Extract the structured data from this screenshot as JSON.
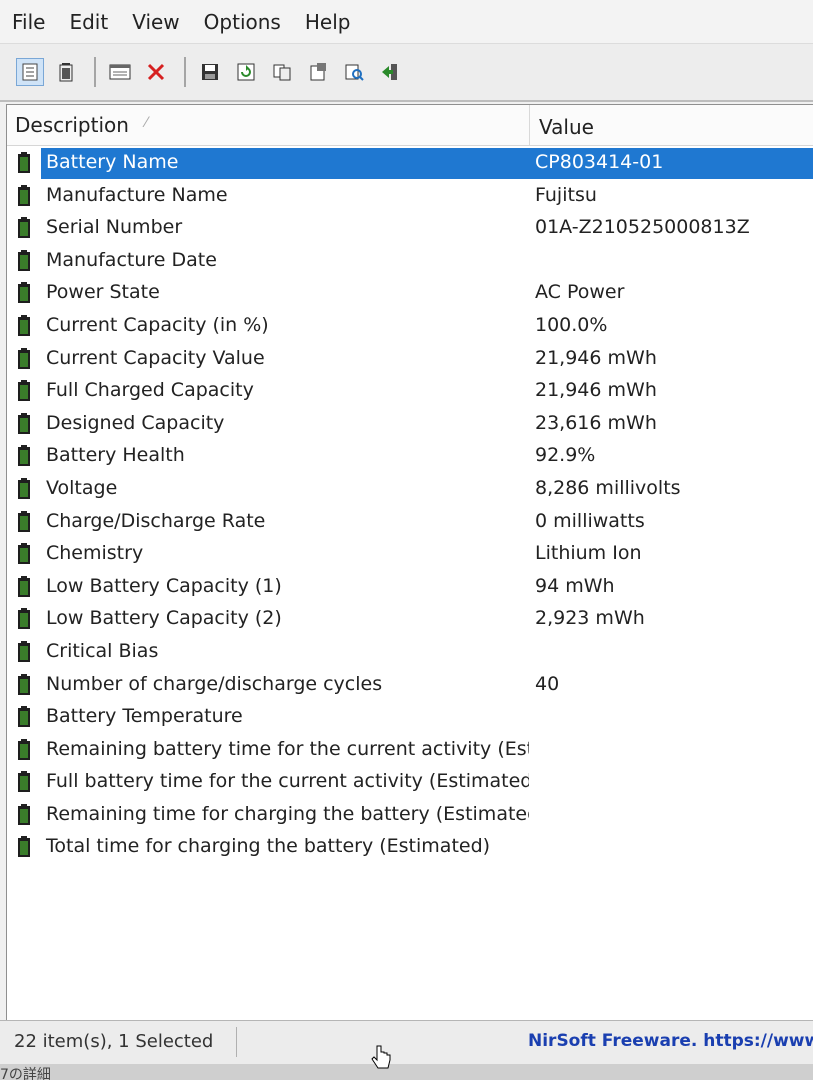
{
  "menu": {
    "file": "File",
    "edit": "Edit",
    "view": "View",
    "options": "Options",
    "help": "Help"
  },
  "toolbar": {
    "icons": [
      "details-view-icon",
      "battery-view-icon",
      "properties-icon",
      "delete-icon",
      "save-icon",
      "refresh-icon",
      "copy-icon",
      "html-report-icon",
      "find-icon",
      "exit-icon"
    ]
  },
  "columns": {
    "description": "Description",
    "value": "Value"
  },
  "rows": [
    {
      "description": "Battery Name",
      "value": "CP803414-01"
    },
    {
      "description": "Manufacture Name",
      "value": "Fujitsu"
    },
    {
      "description": "Serial Number",
      "value": "01A-Z210525000813Z"
    },
    {
      "description": "Manufacture Date",
      "value": ""
    },
    {
      "description": "Power State",
      "value": "AC Power"
    },
    {
      "description": "Current Capacity (in %)",
      "value": "100.0%"
    },
    {
      "description": "Current Capacity Value",
      "value": "21,946 mWh"
    },
    {
      "description": "Full Charged Capacity",
      "value": "21,946 mWh"
    },
    {
      "description": "Designed Capacity",
      "value": "23,616 mWh"
    },
    {
      "description": "Battery Health",
      "value": "92.9%"
    },
    {
      "description": "Voltage",
      "value": "8,286 millivolts"
    },
    {
      "description": "Charge/Discharge Rate",
      "value": "0 milliwatts"
    },
    {
      "description": "Chemistry",
      "value": "Lithium Ion"
    },
    {
      "description": "Low Battery Capacity (1)",
      "value": "94 mWh"
    },
    {
      "description": "Low Battery Capacity (2)",
      "value": "2,923 mWh"
    },
    {
      "description": "Critical Bias",
      "value": ""
    },
    {
      "description": "Number of charge/discharge cycles",
      "value": "40"
    },
    {
      "description": "Battery Temperature",
      "value": ""
    },
    {
      "description": "Remaining battery time for the current activity (Esti...",
      "value": ""
    },
    {
      "description": "Full battery time for the current activity (Estimated)",
      "value": ""
    },
    {
      "description": "Remaining time for charging the battery (Estimated)",
      "value": ""
    },
    {
      "description": "Total  time for charging the battery (Estimated)",
      "value": ""
    }
  ],
  "status": {
    "count": "22 item(s), 1 Selected",
    "link": "NirSoft Freeware. https://www."
  },
  "taskbar": {
    "text": "7の詳細"
  },
  "colors": {
    "selection": "#1f78d1",
    "link": "#1a3fb0",
    "battery_fill": "#3a7d2a"
  }
}
